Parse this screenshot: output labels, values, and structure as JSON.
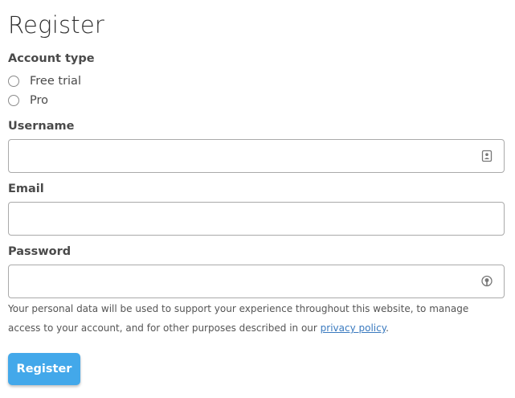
{
  "form": {
    "title": "Register",
    "account_type": {
      "label": "Account type",
      "options": [
        "Free trial",
        "Pro"
      ]
    },
    "username": {
      "label": "Username",
      "value": "",
      "icon": "contact-card-icon"
    },
    "email": {
      "label": "Email",
      "value": ""
    },
    "password": {
      "label": "Password",
      "value": "",
      "icon": "password-manager-icon"
    },
    "privacy": {
      "text_before": "Your personal data will be used to support your experience throughout this website, to manage access to your account, and for other purposes described in our ",
      "link_text": "privacy policy",
      "text_after": "."
    },
    "submit_label": "Register"
  },
  "colors": {
    "accent": "#43a8ea",
    "link": "#3a7abf"
  }
}
